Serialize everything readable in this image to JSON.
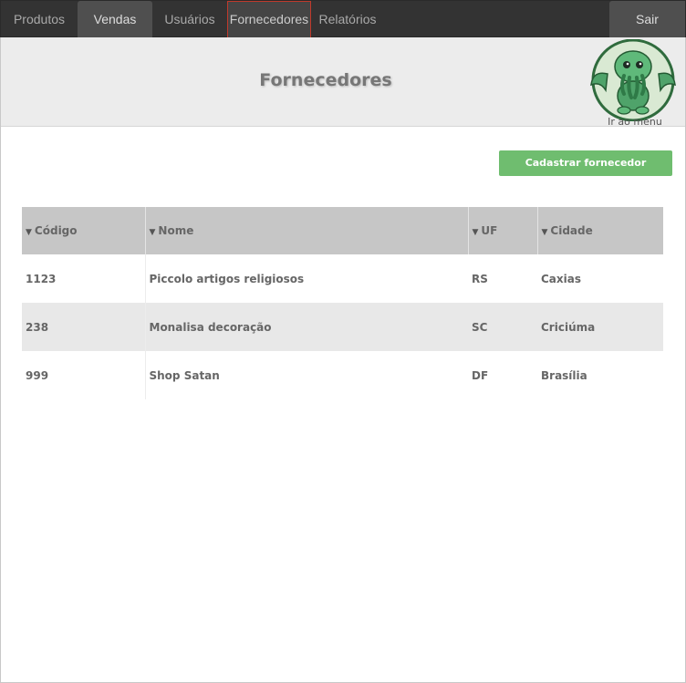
{
  "nav": {
    "items": [
      {
        "label": "Produtos"
      },
      {
        "label": "Vendas"
      },
      {
        "label": "Usuários"
      },
      {
        "label": "Fornecedores"
      },
      {
        "label": "Relatórios"
      }
    ],
    "logout_label": "Sair"
  },
  "header": {
    "title": "Fornecedores",
    "logo_label": "Ir ao menu"
  },
  "actions": {
    "register_label": "Cadastrar fornecedor"
  },
  "table": {
    "columns": [
      "Código",
      "Nome",
      "UF",
      "Cidade"
    ],
    "rows": [
      {
        "codigo": "1123",
        "nome": "Piccolo artigos religiosos",
        "uf": "RS",
        "cidade": "Caxias"
      },
      {
        "codigo": "238",
        "nome": "Monalisa decoração",
        "uf": "SC",
        "cidade": "Criciúma"
      },
      {
        "codigo": "999",
        "nome": "Shop Satan",
        "uf": "DF",
        "cidade": "Brasília"
      }
    ]
  },
  "colors": {
    "nav_bg": "#333333",
    "accent_green": "#6fbd6f",
    "current_outline": "#c0392b"
  }
}
